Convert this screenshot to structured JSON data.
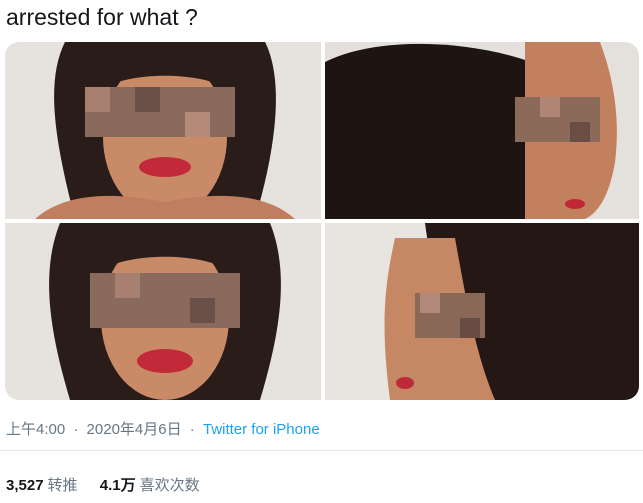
{
  "tweet": {
    "text": "arrested for what ?",
    "time": "上午4:00",
    "separator": "·",
    "date": "2020年4月6日",
    "source": "Twitter for iPhone"
  },
  "stats": {
    "retweets_count": "3,527",
    "retweets_label": "转推",
    "likes_count": "4.1万",
    "likes_label": "喜欢次数"
  },
  "media": {
    "photo_count": 4,
    "blur_applied": "pixelated-eyes"
  }
}
